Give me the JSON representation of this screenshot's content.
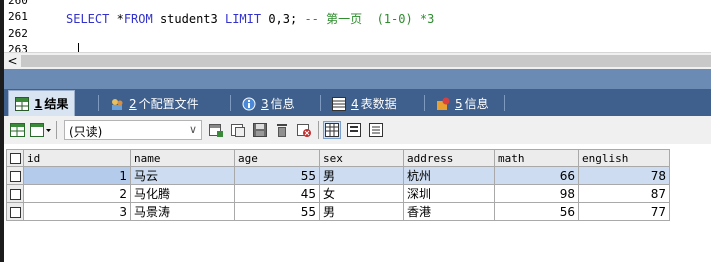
{
  "editor": {
    "line_partial": "260",
    "line1_no": "261",
    "line2_no": "262",
    "line3_no": "263",
    "code_kw1": "SELECT ",
    "code_star": "*",
    "code_kw2": "FROM",
    "code_table": " student3 ",
    "code_kw3": "LIMIT",
    "code_args": " 0,3; ",
    "code_comment": "-- 第一页  (1-0) *3"
  },
  "scroll": {
    "left_arrow": "<"
  },
  "tabs": [
    {
      "num": "1",
      "label": "结果",
      "icon": "result-grid-icon"
    },
    {
      "num": "2",
      "label": "个配置文件",
      "icon": "profile-icon"
    },
    {
      "num": "3",
      "label": "信息",
      "icon": "info-icon"
    },
    {
      "num": "4",
      "label": "表数据",
      "icon": "table-data-icon"
    },
    {
      "num": "5",
      "label": "信息",
      "icon": "info-icon"
    }
  ],
  "toolbar": {
    "mode_value": "(只读)",
    "chevron": "∨",
    "icons": [
      "export-grid-icon",
      "export-dropdown-icon",
      "add-row-icon",
      "copy-row-icon",
      "save-icon",
      "delete-icon",
      "cancel-icon",
      "grid-view-icon",
      "form-view-icon",
      "text-view-icon"
    ]
  },
  "grid": {
    "columns": [
      "id",
      "name",
      "age",
      "sex",
      "address",
      "math",
      "english"
    ],
    "rows": [
      {
        "id": "1",
        "name": "马云",
        "age": "55",
        "sex": "男",
        "address": "杭州",
        "math": "66",
        "english": "78"
      },
      {
        "id": "2",
        "name": "马化腾",
        "age": "45",
        "sex": "女",
        "address": "深圳",
        "math": "98",
        "english": "87"
      },
      {
        "id": "3",
        "name": "马景涛",
        "age": "55",
        "sex": "男",
        "address": "香港",
        "math": "56",
        "english": "77"
      }
    ]
  },
  "colors": {
    "tabbar_bg": "#3f5f8c",
    "splitter": "#6b8bb4",
    "selected_row": "#cddcf0",
    "sql_keyword": "#3333cc",
    "sql_comment": "#2d8c2d"
  }
}
